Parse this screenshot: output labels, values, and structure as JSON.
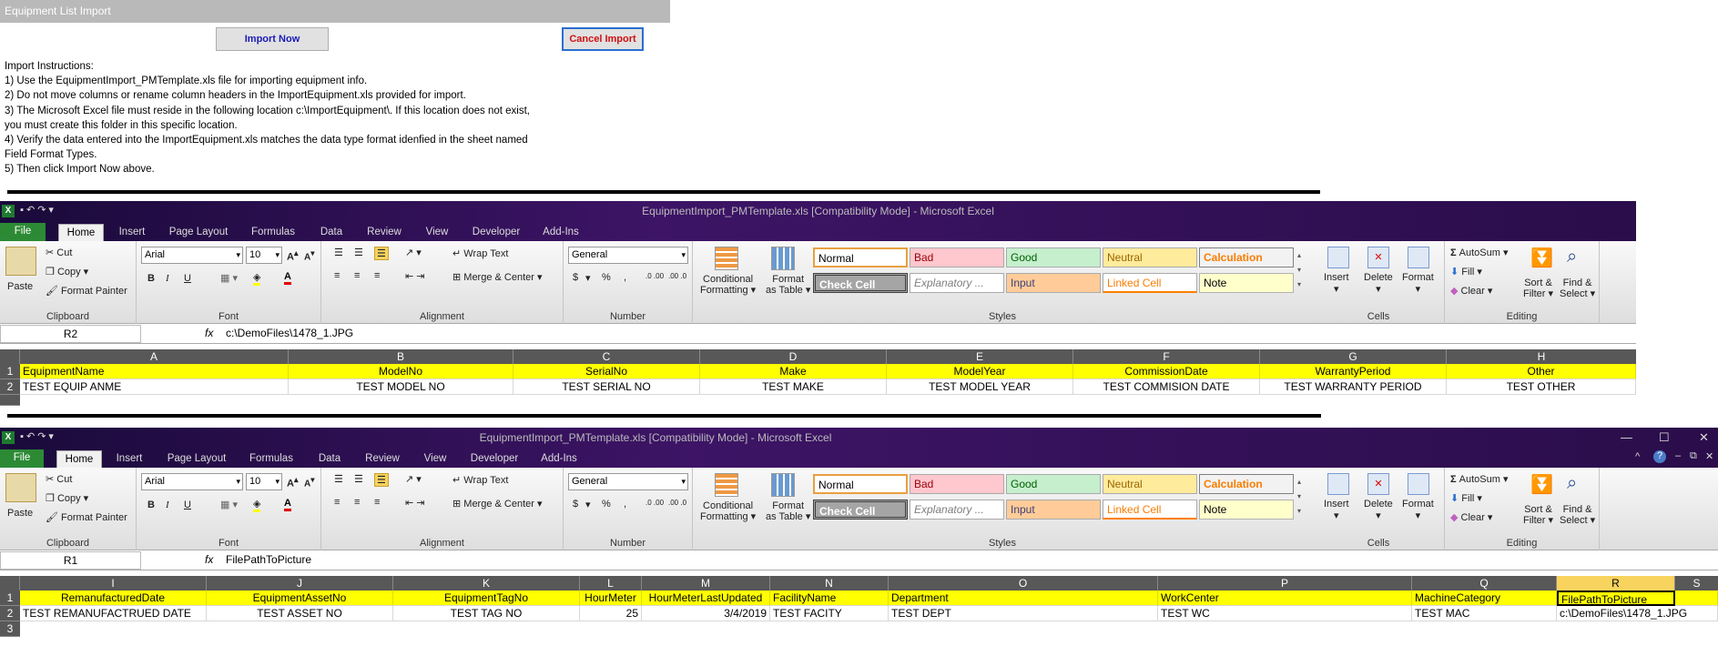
{
  "dialog": {
    "title": "Equipment List Import",
    "import_btn": "Import Now",
    "cancel_btn": "Cancel Import",
    "instructions": [
      "Import Instructions:",
      "1) Use the EquipmentImport_PMTemplate.xls file for importing equipment info.",
      "2) Do not move columns or rename column headers in the ImportEquipment.xls provided for import.",
      "3) The Microsoft Excel file must reside in the following location c:\\ImportEquipment\\. If this location does not exist,",
      "you must create this folder in this specific location.",
      "4) Verify the data entered into the ImportEquipment.xls matches the data type format idenfied in the sheet named",
      "Field Format Types.",
      "5) Then click Import Now above."
    ]
  },
  "excel": {
    "title": "EquipmentImport_PMTemplate.xls  [Compatibility Mode]  -  Microsoft Excel",
    "tabs": [
      "File",
      "Home",
      "Insert",
      "Page Layout",
      "Formulas",
      "Data",
      "Review",
      "View",
      "Developer",
      "Add-Ins"
    ],
    "ribbon": {
      "paste": "Paste",
      "cut": "Cut",
      "copy": "Copy",
      "format_painter": "Format Painter",
      "clipboard": "Clipboard",
      "font_name": "Arial",
      "font_size": "10",
      "font": "Font",
      "bold": "B",
      "italic": "I",
      "underline": "U",
      "wrap_text": "Wrap Text",
      "merge_center": "Merge & Center",
      "alignment": "Alignment",
      "number_format": "General",
      "dollar": "$",
      "percent": "%",
      "comma": ",",
      "inc_dec": ".0 .00",
      "dec_dec": ".00 .0",
      "number": "Number",
      "conditional": "Conditional",
      "formatting": "Formatting",
      "format_as": "Format",
      "as_table": "as Table",
      "styles": [
        "Normal",
        "Bad",
        "Good",
        "Neutral",
        "Calculation",
        "Check Cell",
        "Explanatory ...",
        "Input",
        "Linked Cell",
        "Note"
      ],
      "styles_label": "Styles",
      "insert": "Insert",
      "delete": "Delete",
      "format": "Format",
      "cells": "Cells",
      "autosum": "AutoSum",
      "fill": "Fill",
      "clear": "Clear",
      "sort_filter": "Sort &",
      "filter": "Filter",
      "find_select": "Find &",
      "select": "Select",
      "editing": "Editing"
    }
  },
  "window1": {
    "namebox": "R2",
    "formula": "c:\\DemoFiles\\1478_1.JPG",
    "columns": [
      "A",
      "B",
      "C",
      "D",
      "E",
      "F",
      "G",
      "H"
    ],
    "row_nums": [
      "1",
      "2"
    ],
    "headers": [
      "EquipmentName",
      "ModelNo",
      "SerialNo",
      "Make",
      "ModelYear",
      "CommissionDate",
      "WarrantyPeriod",
      "Other"
    ],
    "values": [
      "TEST EQUIP ANME",
      "TEST MODEL NO",
      "TEST SERIAL NO",
      "TEST MAKE",
      "TEST MODEL YEAR",
      "TEST COMMISION DATE",
      "TEST WARRANTY PERIOD",
      "TEST OTHER"
    ]
  },
  "window2": {
    "namebox": "R1",
    "formula": "FilePathToPicture",
    "columns": [
      "I",
      "J",
      "K",
      "L",
      "M",
      "N",
      "O",
      "P",
      "Q",
      "R",
      "S"
    ],
    "row_nums": [
      "1",
      "2",
      "3"
    ],
    "headers": [
      "RemanufacturedDate",
      "EquipmentAssetNo",
      "EquipmentTagNo",
      "HourMeter",
      "HourMeterLastUpdated",
      "FacilityName",
      "Department",
      "WorkCenter",
      "MachineCategory",
      "FilePathToPicture"
    ],
    "values": [
      "TEST REMANUFACTRUED DATE",
      "TEST ASSET NO",
      "TEST TAG NO",
      "25",
      "3/4/2019",
      "TEST FACITY",
      "TEST DEPT",
      "TEST WC",
      "TEST MAC",
      "c:\\DemoFiles\\1478_1.JPG"
    ]
  },
  "colors": {
    "header_yellow": "#ffff00",
    "file_tab": "#2c8a35",
    "title_purple": "#3d1466",
    "selected_col": "#f8d35e"
  }
}
